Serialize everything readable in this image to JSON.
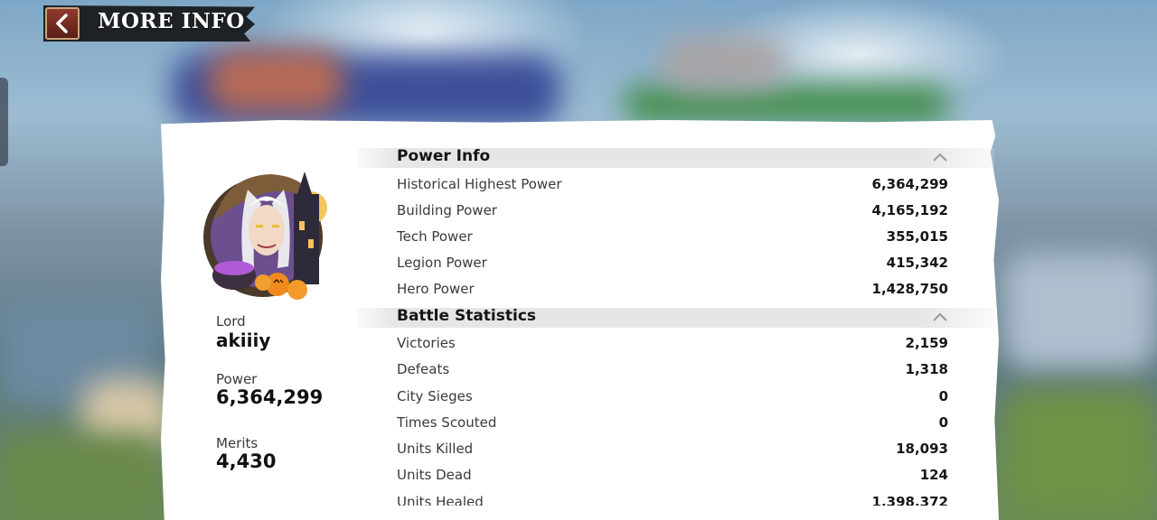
{
  "header": {
    "title": "MORE INFO"
  },
  "profile": {
    "lord_label": "Lord",
    "lord_name": "akiiiy",
    "power_label": "Power",
    "power_value": "6,364,299",
    "merits_label": "Merits",
    "merits_value": "4,430"
  },
  "power_info": {
    "title": "Power Info",
    "rows": [
      {
        "label": "Historical Highest Power",
        "value": "6,364,299"
      },
      {
        "label": "Building Power",
        "value": "4,165,192"
      },
      {
        "label": "Tech Power",
        "value": "355,015"
      },
      {
        "label": "Legion Power",
        "value": "415,342"
      },
      {
        "label": "Hero Power",
        "value": "1,428,750"
      }
    ]
  },
  "battle_statistics": {
    "title": "Battle Statistics",
    "rows": [
      {
        "label": "Victories",
        "value": "2,159"
      },
      {
        "label": "Defeats",
        "value": "1,318"
      },
      {
        "label": "City Sieges",
        "value": "0"
      },
      {
        "label": "Times Scouted",
        "value": "0"
      },
      {
        "label": "Units Killed",
        "value": "18,093"
      },
      {
        "label": "Units Dead",
        "value": "124"
      },
      {
        "label": "Units Healed",
        "value": "1,398,372"
      }
    ]
  },
  "icons": {
    "back": "chevron-left-icon",
    "collapse": "chevron-up-icon",
    "avatar": "lord-avatar"
  }
}
